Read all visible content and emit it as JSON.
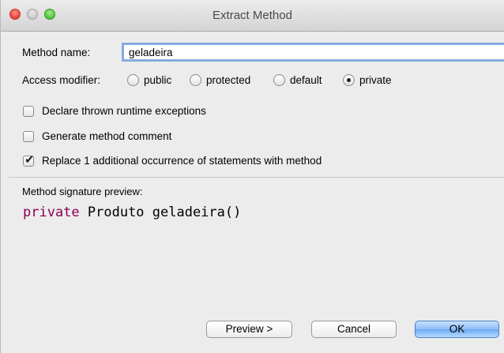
{
  "window": {
    "title": "Extract Method"
  },
  "form": {
    "method_name_label": "Method name:",
    "method_name_value": "geladeira",
    "access_modifier_label": "Access modifier:",
    "access_options": [
      {
        "label": "public",
        "selected": false
      },
      {
        "label": "protected",
        "selected": false
      },
      {
        "label": "default",
        "selected": false
      },
      {
        "label": "private",
        "selected": true
      }
    ],
    "checkboxes": [
      {
        "label": "Declare thrown runtime exceptions",
        "checked": false
      },
      {
        "label": "Generate method comment",
        "checked": false
      },
      {
        "label": "Replace 1 additional occurrence of statements with method",
        "checked": true
      }
    ]
  },
  "preview": {
    "label": "Method signature preview:",
    "keyword": "private",
    "signature_rest": " Produto geladeira()"
  },
  "buttons": {
    "preview": "Preview >",
    "cancel": "Cancel",
    "ok": "OK"
  },
  "colors": {
    "keyword": "#8b0053",
    "focus_ring": "#84abe0",
    "default_button": "#6da9f2"
  }
}
